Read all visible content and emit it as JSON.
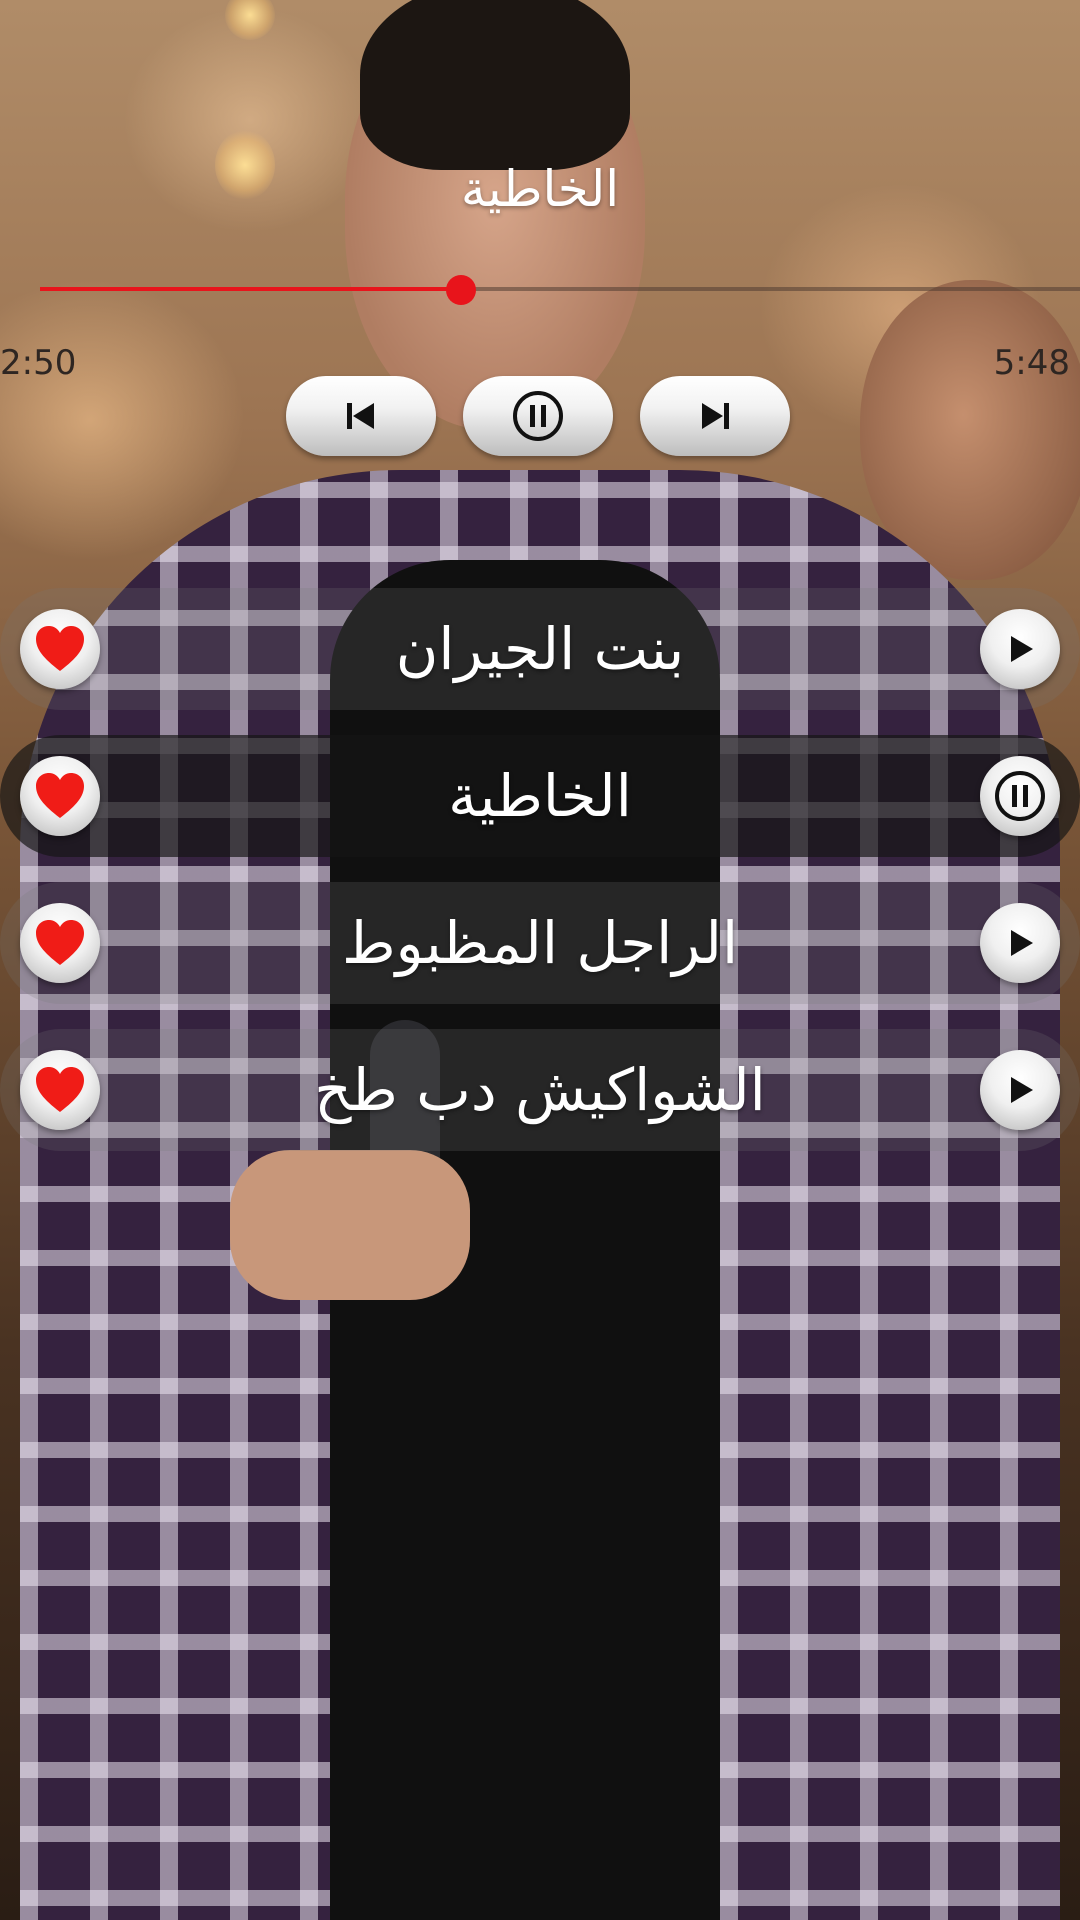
{
  "player": {
    "now_playing_title": "الخاطية",
    "progress_fraction": 0.405,
    "current_time": "2:50",
    "total_time": "5:48",
    "controls": {
      "previous_icon": "skip-previous-icon",
      "pause_icon": "pause-icon",
      "next_icon": "skip-next-icon"
    }
  },
  "playlist": {
    "items": [
      {
        "title": "بنت الجيران",
        "state": "play-icon",
        "favorite": true
      },
      {
        "title": "الخاطية",
        "state": "pause-icon",
        "favorite": true,
        "active": true
      },
      {
        "title": "الراجل المظبوط",
        "state": "play-icon",
        "favorite": true
      },
      {
        "title": "الشواكيش دب طخ",
        "state": "play-icon",
        "favorite": true
      }
    ]
  },
  "colors": {
    "accent": "#e8141b",
    "heart": "#f01c17"
  }
}
